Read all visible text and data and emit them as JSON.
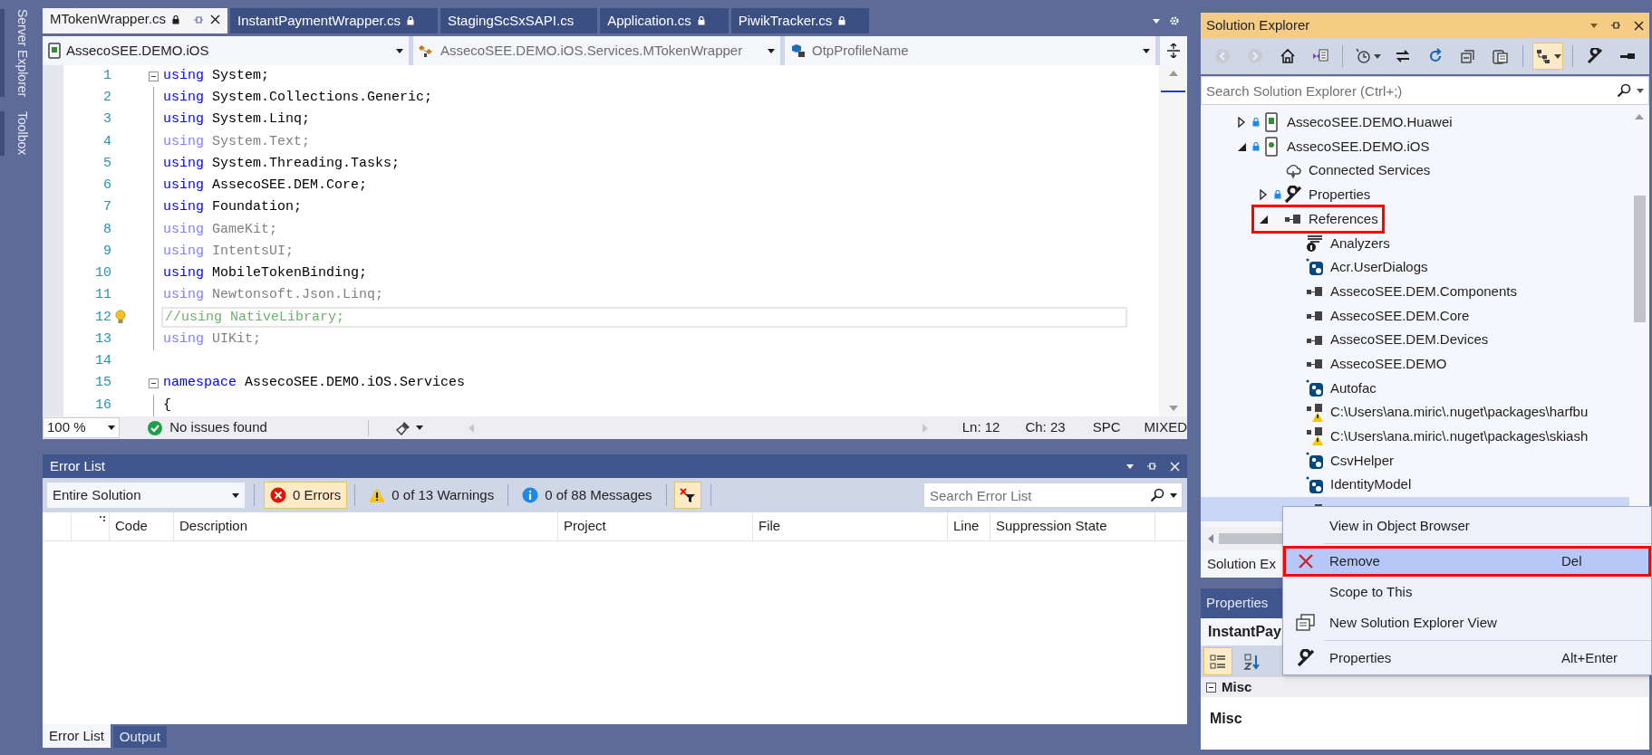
{
  "side_tabs": [
    {
      "label": "Server Explorer"
    },
    {
      "label": "Toolbox"
    }
  ],
  "editor": {
    "tabs": [
      {
        "label": "MTokenWrapper.cs",
        "locked": true,
        "selected": true
      },
      {
        "label": "InstantPaymentWrapper.cs",
        "locked": true,
        "selected": false
      },
      {
        "label": "StagingScSxSAPI.cs",
        "locked": false,
        "selected": false
      },
      {
        "label": "Application.cs",
        "locked": true,
        "selected": false
      },
      {
        "label": "PiwikTracker.cs",
        "locked": true,
        "selected": false
      }
    ],
    "nav": {
      "project": "AssecoSEE.DEMO.iOS",
      "type": "AssecoSEE.DEMO.iOS.Services.MTokenWrapper",
      "member": "OtpProfileName"
    },
    "lines": [
      {
        "number": "1",
        "fold": true,
        "current": false,
        "lightbulb": false,
        "tokens": [
          {
            "kind": "keyword",
            "text": "using"
          },
          {
            "kind": "plain",
            "text": " System;"
          }
        ]
      },
      {
        "number": "2",
        "fold": false,
        "current": false,
        "lightbulb": false,
        "tokens": [
          {
            "kind": "keyword",
            "text": "using"
          },
          {
            "kind": "plain",
            "text": " System.Collections.Generic;"
          }
        ]
      },
      {
        "number": "3",
        "fold": false,
        "current": false,
        "lightbulb": false,
        "tokens": [
          {
            "kind": "keyword",
            "text": "using"
          },
          {
            "kind": "plain",
            "text": " System.Linq;"
          }
        ]
      },
      {
        "number": "4",
        "fold": false,
        "current": false,
        "lightbulb": false,
        "tokens": [
          {
            "kind": "keyword_faded",
            "text": "using"
          },
          {
            "kind": "plain_faded",
            "text": " System.Text;"
          }
        ]
      },
      {
        "number": "5",
        "fold": false,
        "current": false,
        "lightbulb": false,
        "tokens": [
          {
            "kind": "keyword",
            "text": "using"
          },
          {
            "kind": "plain",
            "text": " System.Threading.Tasks;"
          }
        ]
      },
      {
        "number": "6",
        "fold": false,
        "current": false,
        "lightbulb": false,
        "tokens": [
          {
            "kind": "keyword",
            "text": "using"
          },
          {
            "kind": "plain",
            "text": " AssecoSEE.DEM.Core;"
          }
        ]
      },
      {
        "number": "7",
        "fold": false,
        "current": false,
        "lightbulb": false,
        "tokens": [
          {
            "kind": "keyword",
            "text": "using"
          },
          {
            "kind": "plain",
            "text": " Foundation;"
          }
        ]
      },
      {
        "number": "8",
        "fold": false,
        "current": false,
        "lightbulb": false,
        "tokens": [
          {
            "kind": "keyword_faded",
            "text": "using"
          },
          {
            "kind": "plain_faded",
            "text": " GameKit;"
          }
        ]
      },
      {
        "number": "9",
        "fold": false,
        "current": false,
        "lightbulb": false,
        "tokens": [
          {
            "kind": "keyword_faded",
            "text": "using"
          },
          {
            "kind": "plain_faded",
            "text": " IntentsUI;"
          }
        ]
      },
      {
        "number": "10",
        "fold": false,
        "current": false,
        "lightbulb": false,
        "tokens": [
          {
            "kind": "keyword",
            "text": "using"
          },
          {
            "kind": "plain",
            "text": " MobileTokenBinding;"
          }
        ]
      },
      {
        "number": "11",
        "fold": false,
        "current": false,
        "lightbulb": false,
        "tokens": [
          {
            "kind": "keyword_faded",
            "text": "using"
          },
          {
            "kind": "plain_faded",
            "text": " Newtonsoft.Json.Linq;"
          }
        ]
      },
      {
        "number": "12",
        "fold": false,
        "current": true,
        "lightbulb": true,
        "tokens": [
          {
            "kind": "comment",
            "text": "//using NativeLibrary;"
          }
        ]
      },
      {
        "number": "13",
        "fold": false,
        "current": false,
        "lightbulb": false,
        "tokens": [
          {
            "kind": "keyword_faded",
            "text": "using"
          },
          {
            "kind": "plain_faded",
            "text": " UIKit;"
          }
        ]
      },
      {
        "number": "14",
        "fold": false,
        "current": false,
        "lightbulb": false
      },
      {
        "number": "15",
        "fold": true,
        "current": false,
        "lightbulb": false,
        "tokens": [
          {
            "kind": "keyword",
            "text": "namespace"
          },
          {
            "kind": "plain",
            "text": " AssecoSEE.DEMO.iOS.Services"
          }
        ]
      },
      {
        "number": "16",
        "fold": false,
        "current": false,
        "lightbulb": false,
        "tokens": [
          {
            "kind": "plain",
            "text": "{"
          }
        ]
      }
    ],
    "status": {
      "zoom": "100 %",
      "issues": "No issues found",
      "line": "Ln: 12",
      "column": "Ch: 23",
      "whitespace": "SPC",
      "line_endings": "MIXED"
    }
  },
  "error_list": {
    "title": "Error List",
    "scope": "Entire Solution",
    "filters": [
      {
        "kind": "error",
        "label": "0 Errors",
        "selected": true
      },
      {
        "kind": "warning",
        "label": "0 of 13 Warnings",
        "selected": false
      },
      {
        "kind": "info",
        "label": "0 of 88 Messages",
        "selected": false
      }
    ],
    "build_filter": {
      "selected": true
    },
    "search": {
      "placeholder": "Search Error List"
    },
    "columns": [
      "Code",
      "Description",
      "Project",
      "File",
      "Line",
      "Suppression State"
    ]
  },
  "bottom_tabs": [
    {
      "label": "Error List",
      "selected": true
    },
    {
      "label": "Output",
      "selected": false
    }
  ],
  "solution_explorer": {
    "title": "Solution Explorer",
    "toolbar": [
      [
        {
          "kind": "back",
          "disabled": true,
          "selected": false
        },
        {
          "kind": "forward",
          "disabled": true,
          "selected": false
        },
        {
          "kind": "home",
          "disabled": false,
          "selected": false
        },
        {
          "kind": "switch_views",
          "disabled": false,
          "selected": false
        }
      ],
      [
        {
          "kind": "pending_changes",
          "disabled": false,
          "selected": false
        },
        {
          "kind": "sync",
          "disabled": false,
          "selected": false
        },
        {
          "kind": "refresh",
          "disabled": false,
          "selected": false
        },
        {
          "kind": "collapse",
          "disabled": false,
          "selected": false
        },
        {
          "kind": "copy",
          "disabled": false,
          "selected": false
        }
      ],
      [
        {
          "kind": "show_all",
          "disabled": false,
          "selected": true
        }
      ],
      [
        {
          "kind": "properties",
          "disabled": false,
          "selected": false
        },
        {
          "kind": "preview",
          "disabled": false,
          "selected": false
        }
      ]
    ],
    "search": {
      "placeholder": "Search Solution Explorer (Ctrl+;)"
    },
    "tree": [
      {
        "label": "AssecoSEE.DEMO.Huawei",
        "kind": "android_project",
        "locked": true,
        "expanded": false,
        "selected": false,
        "marked": false
      },
      {
        "label": "AssecoSEE.DEMO.iOS",
        "kind": "ios_project",
        "locked": true,
        "expanded": true,
        "selected": false,
        "marked": false,
        "children": [
          {
            "label": "Connected Services",
            "kind": "cloud",
            "locked": false,
            "selected": false,
            "marked": false
          },
          {
            "label": "Properties",
            "kind": "wrench",
            "locked": true,
            "expanded": false,
            "selected": false,
            "marked": false
          },
          {
            "label": "References",
            "kind": "reference",
            "locked": false,
            "expanded": true,
            "selected": false,
            "marked": true,
            "children": [
              {
                "label": "Analyzers",
                "kind": "analyzer",
                "locked": false,
                "selected": false,
                "marked": false
              },
              {
                "label": "Acr.UserDialogs",
                "kind": "package",
                "locked": false,
                "selected": false,
                "marked": false
              },
              {
                "label": "AssecoSEE.DEM.Components",
                "kind": "reference",
                "locked": false,
                "selected": false,
                "marked": false
              },
              {
                "label": "AssecoSEE.DEM.Core",
                "kind": "reference",
                "locked": false,
                "selected": false,
                "marked": false
              },
              {
                "label": "AssecoSEE.DEM.Devices",
                "kind": "reference",
                "locked": false,
                "selected": false,
                "marked": false
              },
              {
                "label": "AssecoSEE.DEMO",
                "kind": "reference",
                "locked": false,
                "selected": false,
                "marked": false
              },
              {
                "label": "Autofac",
                "kind": "package",
                "locked": false,
                "selected": false,
                "marked": false
              },
              {
                "label": "C:\\Users\\ana.miric\\.nuget\\packages\\harfbu",
                "kind": "reference_warning",
                "locked": false,
                "selected": false,
                "marked": false
              },
              {
                "label": "C:\\Users\\ana.miric\\.nuget\\packages\\skiash",
                "kind": "reference_warning",
                "locked": false,
                "selected": false,
                "marked": false
              },
              {
                "label": "CsvHelper",
                "kind": "package",
                "locked": false,
                "selected": false,
                "marked": false
              },
              {
                "label": "IdentityModel",
                "kind": "package",
                "locked": false,
                "selected": false,
                "marked": false
              },
              {
                "kind": "reference",
                "locked": false,
                "selected": true,
                "marked": false
              }
            ]
          }
        ]
      }
    ],
    "tabs": [
      {
        "label": "Solution Ex"
      }
    ]
  },
  "properties": {
    "title": "Properties",
    "object": "InstantPay",
    "toolbar": [
      {
        "kind": "categorized",
        "selected": true
      },
      {
        "kind": "alphabetical",
        "selected": false
      }
    ],
    "category": "Misc",
    "description": "Misc"
  },
  "context_menu": [
    {
      "label": "View in Object Browser",
      "kind": "plain",
      "selected": false,
      "marked": false
    },
    {
      "label": "Remove",
      "shortcut": "Del",
      "kind": "delete",
      "selected": true,
      "marked": true
    },
    {
      "label": "Scope to This",
      "kind": "plain",
      "selected": false,
      "marked": false
    },
    {
      "label": "New Solution Explorer View",
      "kind": "new_view",
      "selected": false,
      "marked": false
    },
    {
      "label": "Properties",
      "shortcut": "Alt+Enter",
      "kind": "wrench",
      "selected": false,
      "marked": false
    }
  ]
}
